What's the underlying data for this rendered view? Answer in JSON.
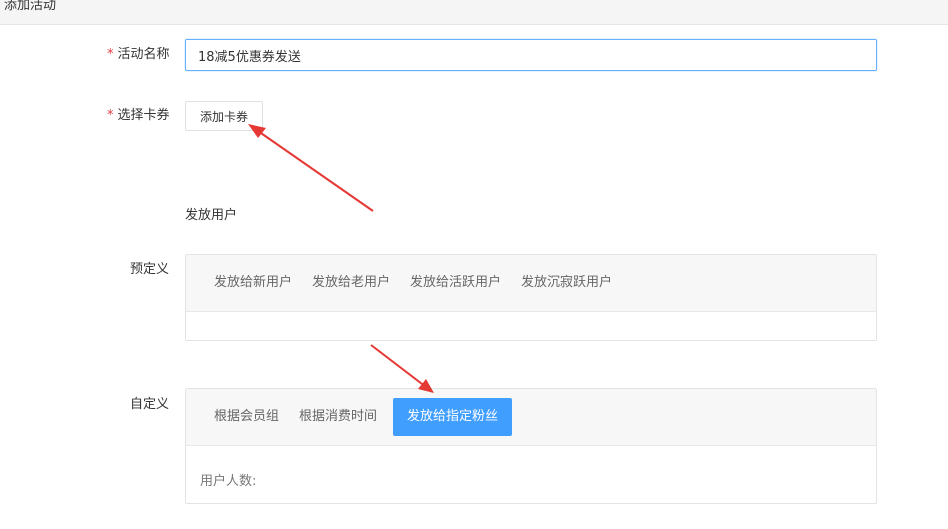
{
  "header": {
    "title": "添加活动"
  },
  "form": {
    "name_label": "活动名称",
    "name_value": "18减5优惠券发送",
    "coupon_label": "选择卡券",
    "add_coupon_button": "添加卡券",
    "required_mark": "*"
  },
  "distribution": {
    "section_title": "发放用户",
    "preset": {
      "label": "预定义",
      "tabs": [
        "发放给新用户",
        "发放给老用户",
        "发放给活跃用户",
        "发放沉寂跃用户"
      ]
    },
    "custom": {
      "label": "自定义",
      "tabs": [
        "根据会员组",
        "根据消费时间",
        "发放给指定粉丝"
      ],
      "active_tab": "发放给指定粉丝",
      "user_count_label": "用户人数:"
    }
  },
  "colors": {
    "accent": "#409eff",
    "required": "#e4393c",
    "annotation": "#e53935"
  }
}
